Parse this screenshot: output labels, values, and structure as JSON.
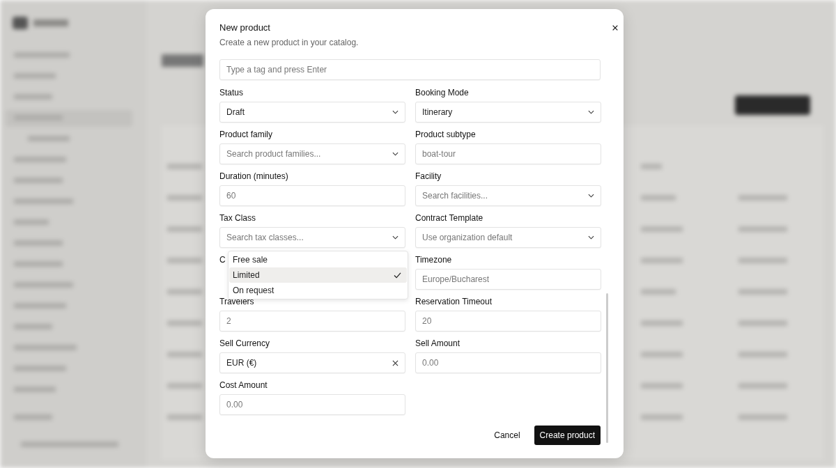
{
  "dialog": {
    "title": "New product",
    "subtitle": "Create a new product in your catalog.",
    "tag_input": {
      "placeholder": "Type a tag and press Enter"
    },
    "fields": [
      {
        "label": "Status",
        "kind": "select",
        "value": "Draft"
      },
      {
        "label": "Booking Mode",
        "kind": "select",
        "value": "Itinerary"
      },
      {
        "label": "Product family",
        "kind": "select",
        "placeholder": "Search product families..."
      },
      {
        "label": "Product subtype",
        "kind": "input",
        "placeholder": "boat-tour"
      },
      {
        "label": "Duration (minutes)",
        "kind": "input",
        "placeholder": "60"
      },
      {
        "label": "Facility",
        "kind": "select",
        "placeholder": "Search facilities..."
      },
      {
        "label": "Tax Class",
        "kind": "select",
        "placeholder": "Search tax classes..."
      },
      {
        "label": "Contract Template",
        "kind": "select",
        "placeholder": "Use organization default"
      },
      {
        "label": "C",
        "kind": "covered",
        "options": [
          {
            "label": "Free sale",
            "selected": false
          },
          {
            "label": "Limited",
            "selected": true
          },
          {
            "label": "On request",
            "selected": false
          }
        ]
      },
      {
        "label": "Timezone",
        "kind": "input",
        "placeholder": "Europe/Bucharest"
      },
      {
        "label": "Travelers",
        "kind": "input",
        "placeholder": "2"
      },
      {
        "label": "Reservation Timeout",
        "kind": "input",
        "placeholder": "20"
      },
      {
        "label": "Sell Currency",
        "kind": "clearable",
        "value": "EUR (€)"
      },
      {
        "label": "Sell Amount",
        "kind": "input",
        "placeholder": "0.00"
      },
      {
        "label": "Cost Amount",
        "kind": "input",
        "placeholder": "0.00"
      }
    ],
    "buttons": {
      "cancel": "Cancel",
      "submit": "Create product"
    }
  }
}
